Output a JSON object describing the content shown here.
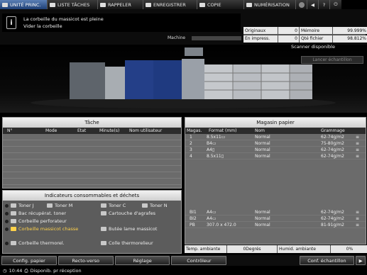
{
  "tabs": [
    {
      "label": "UNITÉ PRINC.",
      "active": true
    },
    {
      "label": "LISTE TÂCHES",
      "active": false
    },
    {
      "label": "RAPPELER",
      "active": false
    },
    {
      "label": "ENREGISTRER",
      "active": false
    },
    {
      "label": "COPIE",
      "active": false
    },
    {
      "label": "NUMÉRISATION",
      "active": false
    }
  ],
  "message": {
    "line1": "La corbeille du massicot est pleine",
    "line2": "Vider la corbeille"
  },
  "stats": {
    "originaux_label": "Originaux",
    "originaux_value": "0",
    "memoire_label": "Mémoire",
    "memoire_value": "99.999%",
    "impress_label": "En impress.",
    "impress_value": "0",
    "qte_label": "Qté fichier",
    "qte_value": "98.812%"
  },
  "machine_label": "Machine",
  "scanner_status": "Scanner disponible",
  "sample_button": "Lancer échantillon",
  "task_panel": {
    "title": "Tâche",
    "columns": [
      "N°",
      "Mode",
      "Etat",
      "Minute(s)",
      "Nom utilisateur"
    ]
  },
  "consumables": {
    "title": "Indicateurs consommables et déchets",
    "items": [
      {
        "label": "Toner J"
      },
      {
        "label": "Toner M"
      },
      {
        "label": "Toner C"
      },
      {
        "label": "Toner N"
      },
      {
        "label": "Bac récupérat. toner"
      },
      {
        "label": "Cartouche d'agrafes"
      },
      {
        "label": "Corbeille perforateur"
      },
      {
        "label": "Corbeille massicot chasse"
      },
      {
        "label": "Butée lame massicot"
      },
      {
        "label": "Corbeille thermorel."
      },
      {
        "label": "Colle thermorelieur"
      }
    ]
  },
  "paper_panel": {
    "title": "Magasin papier",
    "columns": [
      "Magas.",
      "Format (mm)",
      "Nom",
      "Grammage"
    ],
    "trays": [
      {
        "tray": "1",
        "format": "8.5x11▭",
        "name": "Normal",
        "weight": "62-74g/m2"
      },
      {
        "tray": "2",
        "format": "B4▭",
        "name": "Normal",
        "weight": "75-80g/m2"
      },
      {
        "tray": "3",
        "format": "A4▯",
        "name": "Normal",
        "weight": "62-74g/m2"
      },
      {
        "tray": "4",
        "format": "8.5x11▯",
        "name": "Normal",
        "weight": "62-74g/m2"
      }
    ],
    "bottom_trays": [
      {
        "tray": "BI1",
        "format": "A4▭",
        "name": "Normal",
        "weight": "62-74g/m2"
      },
      {
        "tray": "BI2",
        "format": "A4▭",
        "name": "Normal",
        "weight": "62-74g/m2"
      },
      {
        "tray": "PB",
        "format": "307.0 x 472.0",
        "name": "Normal",
        "weight": "81-91g/m2"
      }
    ]
  },
  "ambient": {
    "temp_label": "Temp. ambiante",
    "temp_value": "0Degrés",
    "hum_label": "Humid. ambiante",
    "hum_value": "0%"
  },
  "bottom_buttons": [
    "Config. papier",
    "Recto-verso",
    "Réglage",
    "Contrôleur",
    "Conf. échantillon"
  ],
  "status": {
    "time": "10:44",
    "text": "Disponib. pr réception"
  }
}
